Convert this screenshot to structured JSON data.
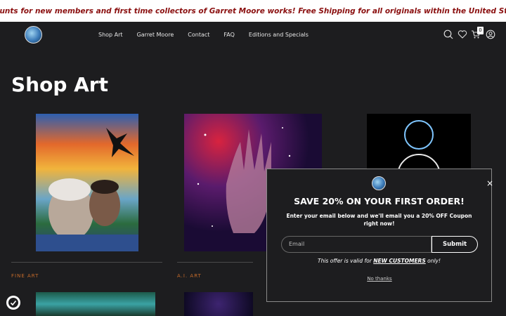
{
  "announcement": {
    "text": "Discounts for new members and first time collectors of Garret Moore works! Free Shipping for all originals within the United States!"
  },
  "header": {
    "nav": [
      "Shop Art",
      "Garret Moore",
      "Contact",
      "FAQ",
      "Editions and Specials"
    ],
    "icons": [
      "search-icon",
      "heart-icon",
      "cart-icon",
      "account-icon"
    ],
    "cart_count": "0"
  },
  "page": {
    "title": "Shop Art"
  },
  "products": [
    {
      "category": "FINE ART"
    },
    {
      "category": "A.I. ART"
    }
  ],
  "popup": {
    "heading": "SAVE 20% ON YOUR FIRST ORDER!",
    "subtext": "Enter your email below and we'll email you a 20% OFF Coupon right now!",
    "email_placeholder": "Email",
    "submit_label": "Submit",
    "validity_prefix": "This offer is valid for ",
    "validity_highlight": "NEW CUSTOMERS",
    "validity_suffix": " only!",
    "no_thanks": "No thanks",
    "close": "×"
  },
  "colors": {
    "announcement_text": "#8b1010",
    "category": "#c46a2a",
    "background": "#1d1d1f"
  }
}
